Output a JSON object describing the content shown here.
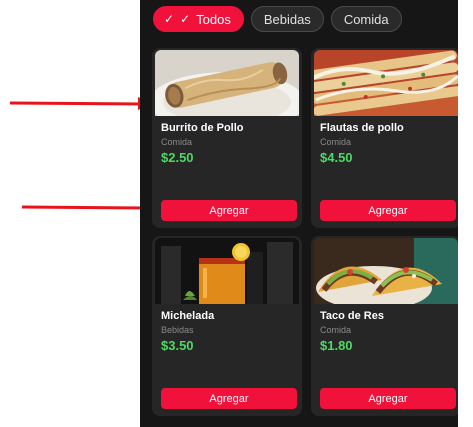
{
  "filters": [
    {
      "label": "Todos",
      "active": true
    },
    {
      "label": "Bebidas",
      "active": false
    },
    {
      "label": "Comida",
      "active": false
    }
  ],
  "products": [
    {
      "name": "Burrito de Pollo",
      "category": "Comida",
      "price": "$2.50",
      "button": "Agregar"
    },
    {
      "name": "Flautas de pollo",
      "category": "Comida",
      "price": "$4.50",
      "button": "Agregar"
    },
    {
      "name": "Michelada",
      "category": "Bebidas",
      "price": "$3.50",
      "button": "Agregar"
    },
    {
      "name": "Taco de Res",
      "category": "Comida",
      "price": "$1.80",
      "button": "Agregar"
    }
  ],
  "colors": {
    "accent": "#f0123b",
    "price": "#4cd964",
    "background": "#161616",
    "card": "#262626",
    "annotation_arrow": "#e8141c"
  }
}
